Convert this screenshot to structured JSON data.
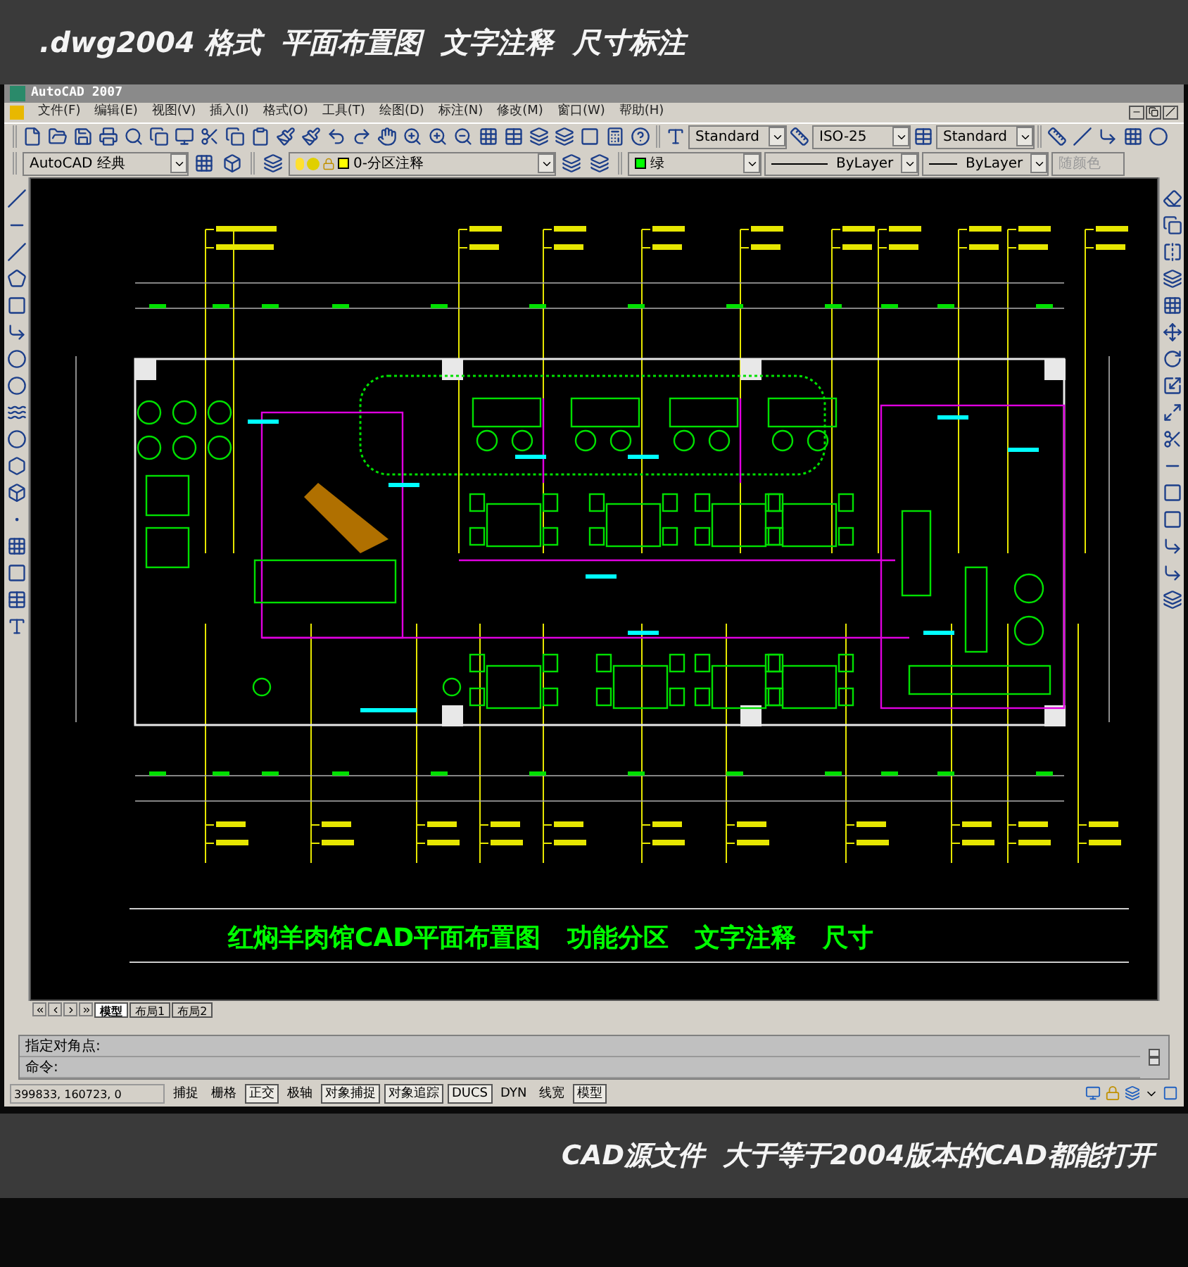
{
  "banner": {
    "title": ".dwg2004 格式  平面布置图  文字注释  尺寸标注"
  },
  "window": {
    "title": "AutoCAD 2007"
  },
  "menu": [
    "文件(F)",
    "编辑(E)",
    "视图(V)",
    "插入(I)",
    "格式(O)",
    "工具(T)",
    "绘图(D)",
    "标注(N)",
    "修改(M)",
    "窗口(W)",
    "帮助(H)"
  ],
  "styles": {
    "text_style": "Standard",
    "dim_style": "ISO-25",
    "table_style": "Standard"
  },
  "properties": {
    "workspace": "AutoCAD 经典",
    "layer": "0-分区注释",
    "color": {
      "label": "绿",
      "color": "#00ff00"
    },
    "linetype": "ByLayer",
    "lineweight": "ByLayer",
    "plot_style": {
      "label": "随颜色",
      "disabled": true
    }
  },
  "drawing": {
    "title": "红焖羊肉馆CAD平面布置图   功能分区   文字注释   尺寸"
  },
  "layout_tabs": [
    {
      "label": "模型",
      "selected": true
    },
    {
      "label": "布局1",
      "selected": false
    },
    {
      "label": "布局2",
      "selected": false
    }
  ],
  "command_lines": [
    "指定对角点:",
    "命令:"
  ],
  "status_bar": {
    "coordinates": "399833, 160723, 0",
    "toggles": [
      {
        "label": "捕捉",
        "on": false
      },
      {
        "label": "栅格",
        "on": false
      },
      {
        "label": "正交",
        "on": true
      },
      {
        "label": "极轴",
        "on": false
      },
      {
        "label": "对象捕捉",
        "on": true
      },
      {
        "label": "对象追踪",
        "on": true
      },
      {
        "label": "DUCS",
        "on": true
      },
      {
        "label": "DYN",
        "on": false
      },
      {
        "label": "线宽",
        "on": false
      },
      {
        "label": "模型",
        "on": true
      }
    ]
  },
  "caption": "CAD源文件  大于等于2004版本的CAD都能打开"
}
